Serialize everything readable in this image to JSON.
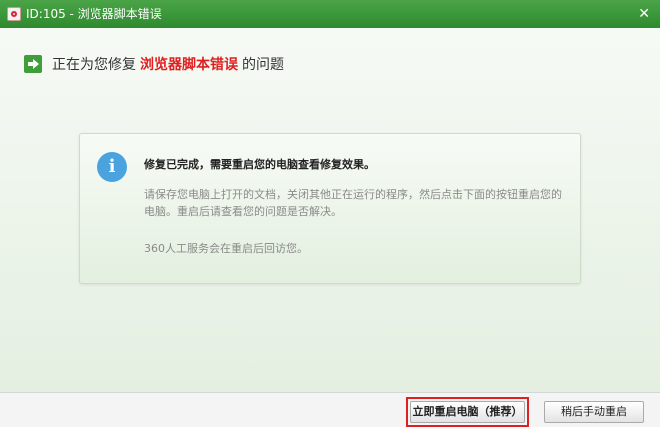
{
  "window": {
    "title": "ID:105 - 浏览器脚本错误",
    "close_glyph": "✕"
  },
  "header": {
    "prefix": "正在为您修复",
    "highlight": "浏览器脚本错误",
    "suffix": "的问题"
  },
  "message": {
    "icon_glyph": "i",
    "title": "修复已完成，需要重启您的电脑查看修复效果。",
    "body": "请保存您电脑上打开的文档，关闭其他正在运行的程序，然后点击下面的按钮重启您的电脑。重启后请查看您的问题是否解决。",
    "note": "360人工服务会在重启后回访您。"
  },
  "footer": {
    "restart_now_label": "立即重启电脑（推荐）",
    "restart_later_label": "稍后手动重启"
  },
  "colors": {
    "titlebar": "#3a9a37",
    "highlight": "#e02020",
    "info": "#4aa3df"
  }
}
